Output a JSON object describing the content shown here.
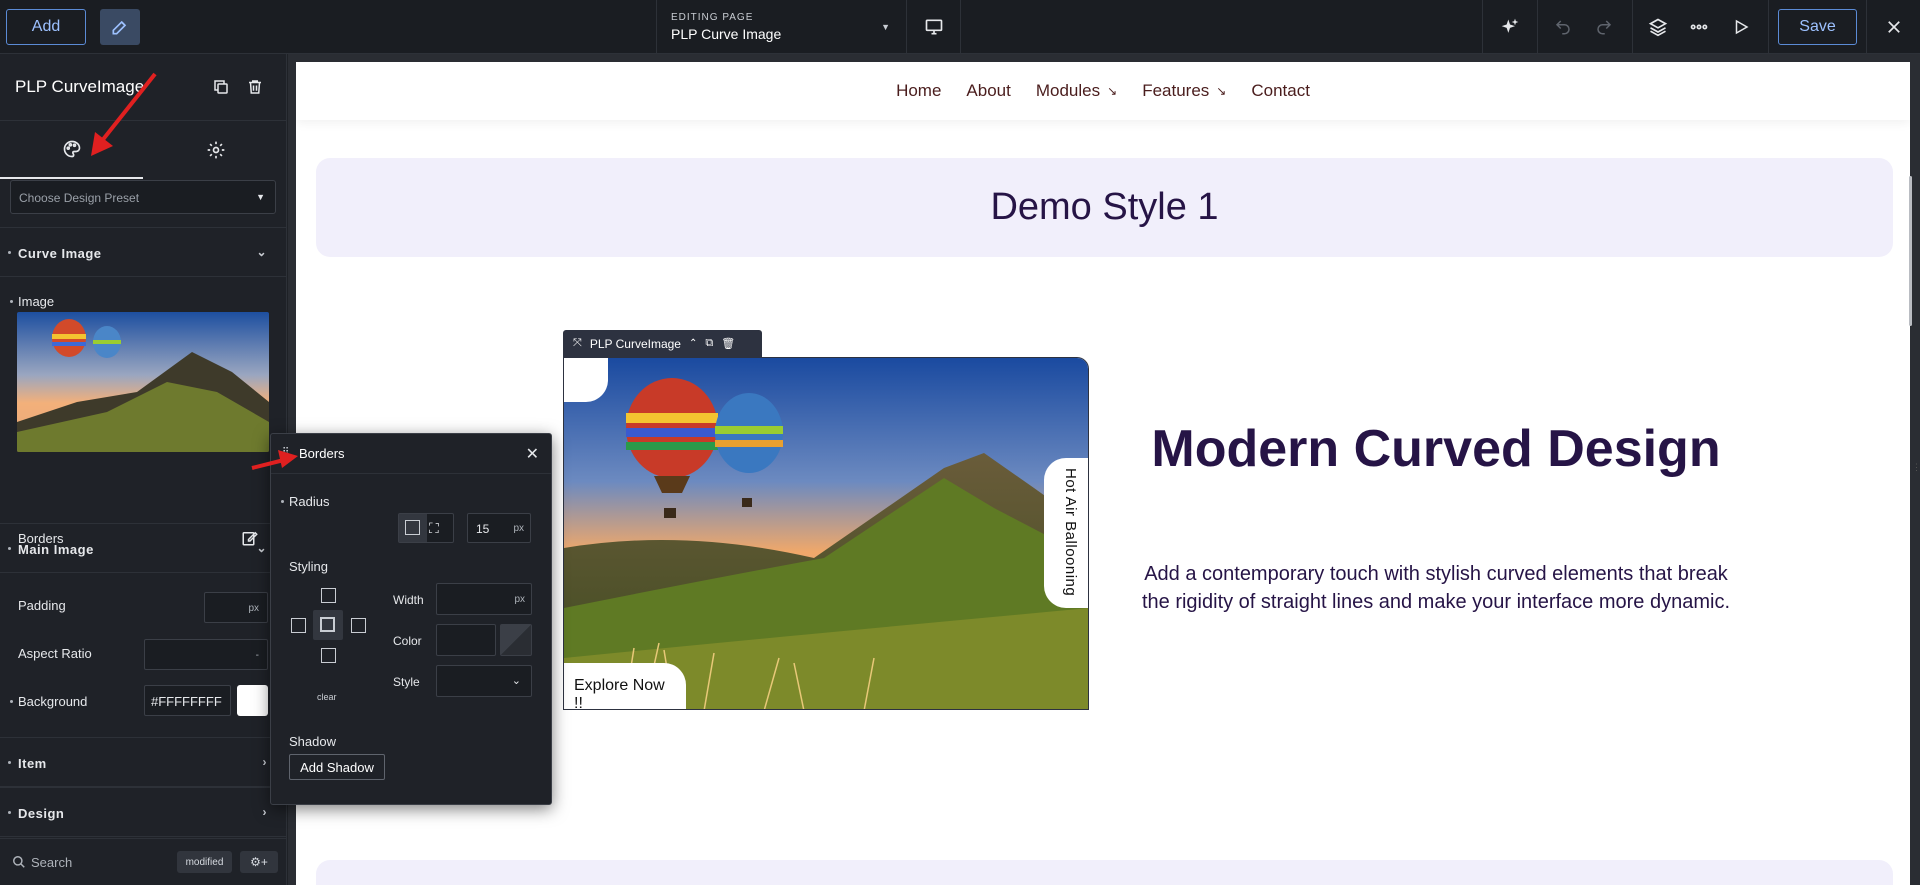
{
  "topbar": {
    "add_label": "Add",
    "editing_label": "EDITING PAGE",
    "editing_value": "PLP Curve Image",
    "save_label": "Save"
  },
  "panel": {
    "title": "PLP CurveImage",
    "preset_placeholder": "Choose Design Preset",
    "sections": {
      "curve_image": "Curve Image",
      "main_image": "Main Image",
      "item": "Item",
      "design": "Design"
    },
    "image_label": "Image",
    "borders_label": "Borders",
    "padding_label": "Padding",
    "padding_unit": "px",
    "aspect_ratio_label": "Aspect Ratio",
    "aspect_ratio_value": "-",
    "background_label": "Background",
    "background_value": "#FFFFFFFF",
    "search_placeholder": "Search",
    "modified_label": "modified"
  },
  "borders_popover": {
    "title": "Borders",
    "radius_label": "Radius",
    "radius_value": "15",
    "radius_unit": "px",
    "styling_label": "Styling",
    "width_label": "Width",
    "width_unit": "px",
    "color_label": "Color",
    "style_label": "Style",
    "clear_label": "clear",
    "shadow_label": "Shadow",
    "add_shadow_label": "Add Shadow"
  },
  "site": {
    "nav": [
      "Home",
      "About",
      "Modules",
      "Features",
      "Contact"
    ],
    "banner_title": "Demo Style 1",
    "module_tag": "PLP CurveImage",
    "explore_label": "Explore Now !!",
    "vertical_label": "Hot Air Ballooning",
    "hero_title": "Modern Curved Design",
    "hero_desc": "Add a contemporary touch with stylish curved elements that break the rigidity of straight lines and make your interface more dynamic."
  },
  "colors": {
    "accent": "#5b8bd6",
    "panel_bg": "#1f2228",
    "heading": "#261446",
    "nav_text": "#4a1d1d",
    "banner_bg": "#f1effb",
    "annotation_arrow": "#e02020"
  }
}
